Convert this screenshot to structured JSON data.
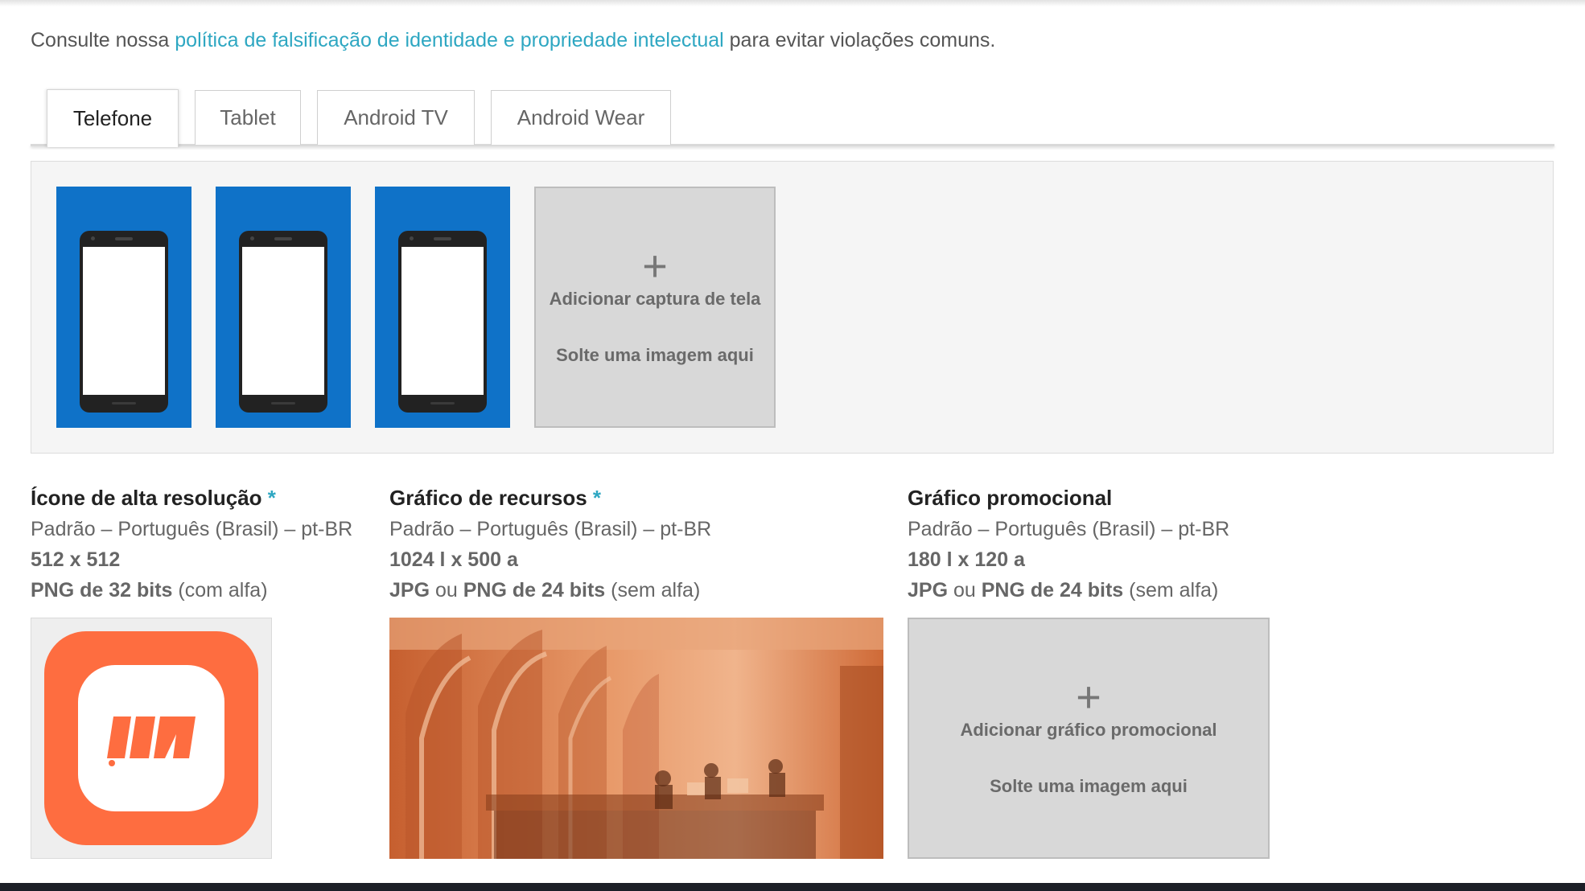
{
  "notice": {
    "prefix": "Consulte nossa ",
    "link": "política de falsificação de identidade e propriedade intelectual",
    "suffix": " para evitar violações comuns."
  },
  "tabs": [
    {
      "label": "Telefone",
      "active": true
    },
    {
      "label": "Tablet",
      "active": false
    },
    {
      "label": "Android TV",
      "active": false
    },
    {
      "label": "Android Wear",
      "active": false
    }
  ],
  "screenshots": {
    "count": 3,
    "add_label": "Adicionar captura de tela",
    "drop_label": "Solte uma imagem aqui"
  },
  "graphics": {
    "icon": {
      "title": "Ícone de alta resolução",
      "required": "*",
      "language": "Padrão – Português (Brasil) – pt-BR",
      "size": "512 x 512",
      "format_bold": "PNG de 32 bits",
      "format_rest": " (com alfa)"
    },
    "feature": {
      "title": "Gráfico de recursos",
      "required": "*",
      "language": "Padrão – Português (Brasil) – pt-BR",
      "size": "1024 l x 500 a",
      "format_a": "JPG",
      "format_or": " ou ",
      "format_b": "PNG de 24 bits",
      "format_rest": " (sem alfa)"
    },
    "promo": {
      "title": "Gráfico promocional",
      "language": "Padrão – Português (Brasil) – pt-BR",
      "size": "180 l x 120 a",
      "format_a": "JPG",
      "format_or": " ou ",
      "format_b": "PNG de 24 bits",
      "format_rest": " (sem alfa)",
      "add_label": "Adicionar gráfico promocional",
      "drop_label": "Solte uma imagem aqui"
    }
  },
  "colors": {
    "link": "#2ea7c2",
    "screenshot_bg": "#0f72c8",
    "icon_orange": "#fe6d40",
    "feature_tint": "#d06d3c"
  }
}
